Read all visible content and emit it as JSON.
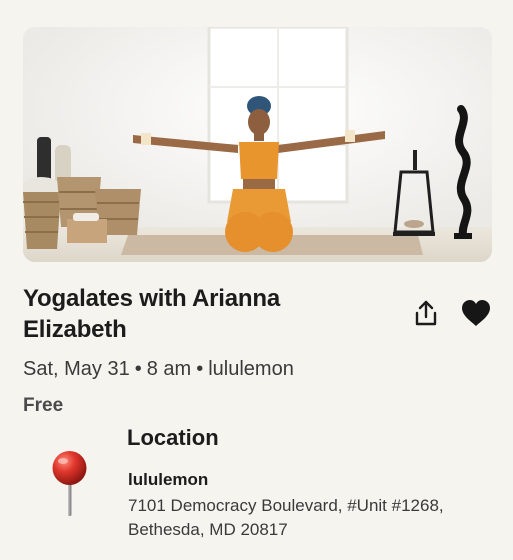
{
  "event": {
    "title": "Yogalates with Arianna Elizabeth",
    "date": "Sat, May 31",
    "time": "8 am",
    "organizer": "lululemon",
    "separator": "•",
    "price": "Free"
  },
  "actions": {
    "share_icon": "share-icon",
    "like_icon": "heart-icon"
  },
  "location": {
    "heading": "Location",
    "icon": "map-pin-icon",
    "venue_name": "lululemon",
    "address": "7101 Democracy Boulevard, #Unit #1268, Bethesda, MD 20817"
  },
  "colors": {
    "background": "#f5f4ef",
    "text": "#1c1c1c",
    "pin_red": "#d8302a"
  }
}
